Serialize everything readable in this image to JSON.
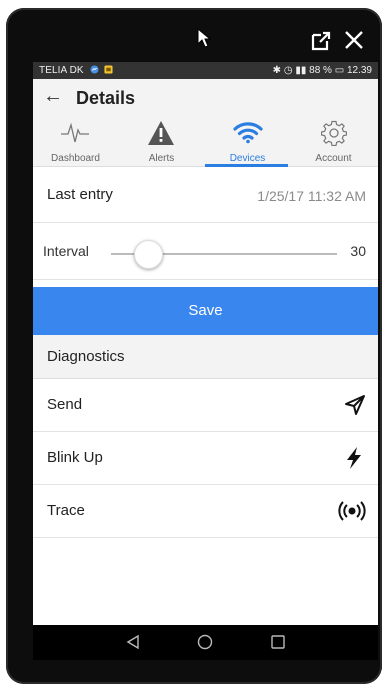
{
  "status_bar": {
    "carrier": "TELIA DK",
    "battery": "88 %",
    "time": "12.39"
  },
  "app_bar": {
    "title": "Details"
  },
  "tabs": [
    {
      "label": "Dashboard",
      "icon": "pulse-icon",
      "active": false
    },
    {
      "label": "Alerts",
      "icon": "warning-icon",
      "active": false
    },
    {
      "label": "Devices",
      "icon": "wifi-icon",
      "active": true
    },
    {
      "label": "Account",
      "icon": "gear-icon",
      "active": false
    }
  ],
  "last_entry": {
    "label": "Last entry",
    "value": "1/25/17 11:32 AM"
  },
  "interval": {
    "label": "Interval",
    "value": "30"
  },
  "save_label": "Save",
  "diagnostics": {
    "header": "Diagnostics",
    "items": [
      {
        "label": "Send",
        "icon": "send-icon"
      },
      {
        "label": "Blink Up",
        "icon": "lightning-icon"
      },
      {
        "label": "Trace",
        "icon": "broadcast-icon"
      }
    ]
  },
  "colors": {
    "accent": "#2a7de1",
    "save_button": "#3a86ef"
  }
}
